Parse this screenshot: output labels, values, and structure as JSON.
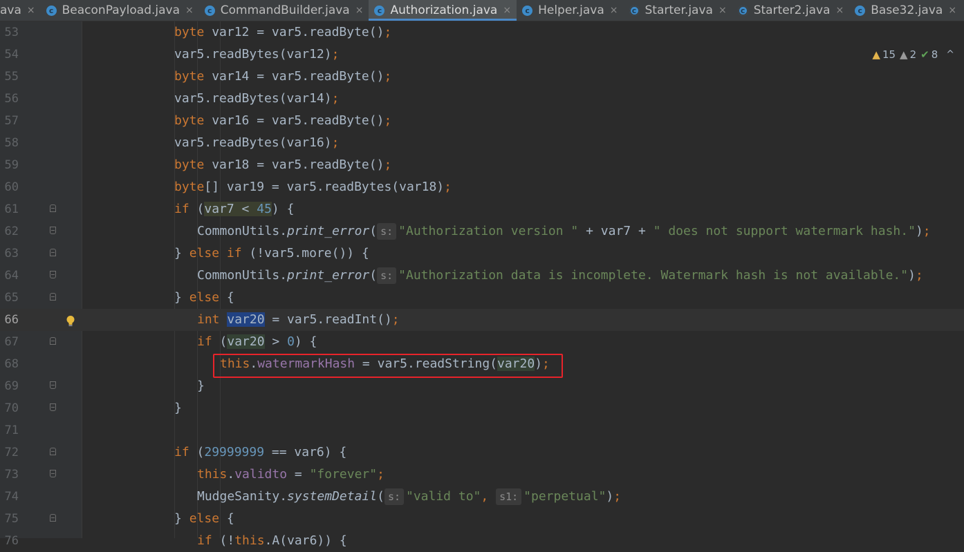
{
  "tabs": [
    {
      "label": "ava",
      "icon": "",
      "active": false
    },
    {
      "label": "BeaconPayload.java",
      "icon": "class-icon",
      "active": false
    },
    {
      "label": "CommandBuilder.java",
      "icon": "class-icon",
      "active": false
    },
    {
      "label": "Authorization.java",
      "icon": "class-icon",
      "active": true
    },
    {
      "label": "Helper.java",
      "icon": "class-icon",
      "active": false
    },
    {
      "label": "Starter.java",
      "icon": "runnable-class-icon",
      "active": false
    },
    {
      "label": "Starter2.java",
      "icon": "runnable-class-icon",
      "active": false
    },
    {
      "label": "Base32.java",
      "icon": "class-icon",
      "active": false
    }
  ],
  "tab_close_glyph": "×",
  "tab_icon_glyph": "c",
  "inspections": {
    "warnings": "15",
    "weak_warnings": "2",
    "ok": "8"
  },
  "lines": [
    {
      "n": "53"
    },
    {
      "n": "54"
    },
    {
      "n": "55"
    },
    {
      "n": "56"
    },
    {
      "n": "57"
    },
    {
      "n": "58"
    },
    {
      "n": "59"
    },
    {
      "n": "60"
    },
    {
      "n": "61"
    },
    {
      "n": "62"
    },
    {
      "n": "63"
    },
    {
      "n": "64"
    },
    {
      "n": "65"
    },
    {
      "n": "66"
    },
    {
      "n": "67"
    },
    {
      "n": "68"
    },
    {
      "n": "69"
    },
    {
      "n": "70"
    },
    {
      "n": "71"
    },
    {
      "n": "72"
    },
    {
      "n": "73"
    },
    {
      "n": "74"
    },
    {
      "n": "75"
    },
    {
      "n": "76"
    }
  ],
  "code": {
    "l53": {
      "kw": "byte",
      "rest": " var12 = var5.readByte()",
      "semi": ";"
    },
    "l54": {
      "rest": "var5.readBytes(var12)",
      "semi": ";"
    },
    "l55": {
      "kw": "byte",
      "rest": " var14 = var5.readByte()",
      "semi": ";"
    },
    "l56": {
      "rest": "var5.readBytes(var14)",
      "semi": ";"
    },
    "l57": {
      "kw": "byte",
      "rest": " var16 = var5.readByte()",
      "semi": ";"
    },
    "l58": {
      "rest": "var5.readBytes(var16)",
      "semi": ";"
    },
    "l59": {
      "kw": "byte",
      "rest": " var18 = var5.readByte()",
      "semi": ";"
    },
    "l60": {
      "kw": "byte",
      "rest": "[] var19 = var5.readBytes(var18)",
      "semi": ";"
    },
    "l61": {
      "kw": "if",
      "open": " (",
      "cond": "var7 < ",
      "num": "45",
      "close": ") {"
    },
    "l62": {
      "cls": "CommonUtils.",
      "method": "print_error",
      "paren": "(",
      "hint": "s:",
      "str1": "\"Authorization version \"",
      "mid": " + var7 + ",
      "str2": "\" does not support watermark hash.\"",
      "end": ")",
      "semi": ";"
    },
    "l63": {
      "close": "} ",
      "kw1": "else",
      "sp": " ",
      "kw2": "if",
      "rest": " (!var5.more()) {"
    },
    "l64": {
      "cls": "CommonUtils.",
      "method": "print_error",
      "paren": "(",
      "hint": "s:",
      "str": "\"Authorization data is incomplete. Watermark hash is not available.\"",
      "end": ")",
      "semi": ";"
    },
    "l65": {
      "close": "} ",
      "kw": "else",
      "rest": " {"
    },
    "l66": {
      "kw": "int",
      "sp": " ",
      "var": "var20",
      "rest": " = var5.readInt()",
      "semi": ";"
    },
    "l67": {
      "kw": "if",
      "open": " (",
      "var": "var20",
      "rest": " > ",
      "num": "0",
      "close": ") {"
    },
    "l68": {
      "kw": "this",
      "dot": ".",
      "fld": "watermarkHash",
      "rest": " = var5.readString(",
      "var": "var20",
      "end": ")",
      "semi": ";"
    },
    "l69": {
      "rest": "}"
    },
    "l70": {
      "rest": "}"
    },
    "l71": {
      "rest": ""
    },
    "l72": {
      "kw": "if",
      "open": " (",
      "num": "29999999",
      "rest": " == var6) {"
    },
    "l73": {
      "kw": "this",
      "dot": ".",
      "fld": "validto",
      "eq": " = ",
      "str": "\"forever\"",
      "semi": ";"
    },
    "l74": {
      "cls": "MudgeSanity.",
      "method": "systemDetail",
      "paren": "(",
      "hint1": "s:",
      "str1": "\"valid to\"",
      "comma": ", ",
      "hint2": "s1:",
      "str2": "\"perpetual\"",
      "end": ")",
      "semi": ";"
    },
    "l75": {
      "close": "} ",
      "kw": "else",
      "rest": " {"
    },
    "l76": {
      "kw": "if",
      "rest": " (!",
      "kw2": "this",
      "rest2": ".A(var6)) {"
    }
  },
  "colors": {
    "keyword": "#cc7832",
    "number": "#6897bb",
    "string": "#6a8759",
    "field": "#9876aa",
    "text": "#a9b7c6",
    "highlight_box": "#e8232a",
    "active_tab_underline": "#4a88c7"
  }
}
